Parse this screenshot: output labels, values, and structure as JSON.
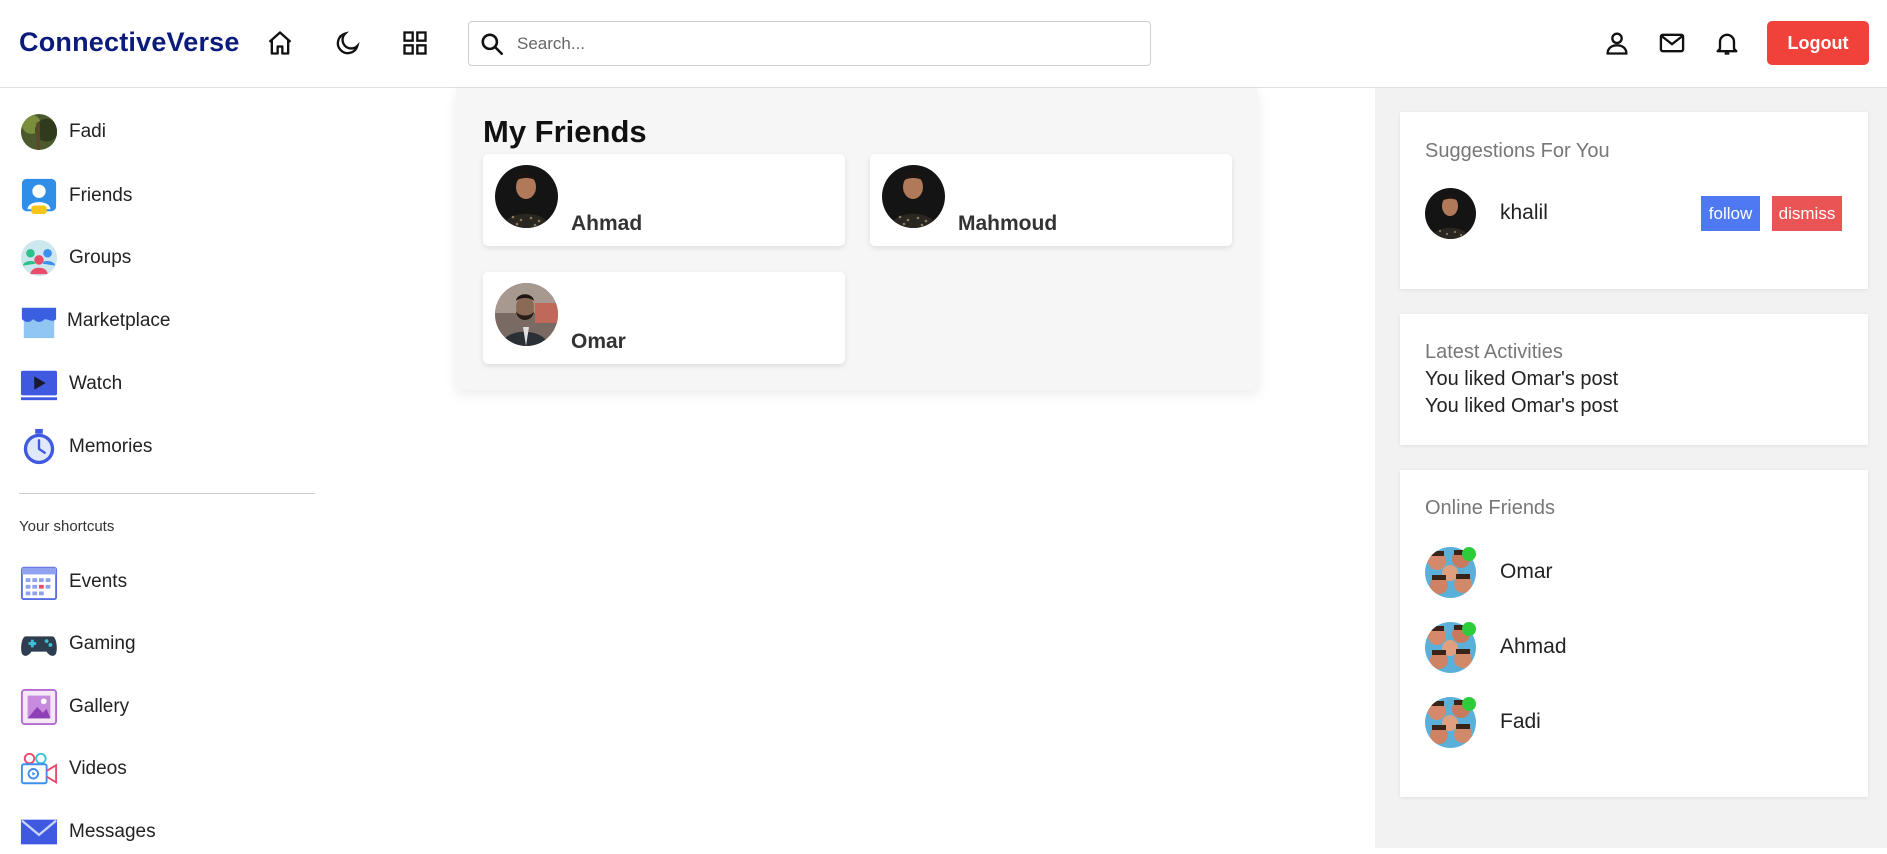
{
  "app": {
    "logo": "ConnectiveVerse"
  },
  "header": {
    "search_placeholder": "Search...",
    "logout_label": "Logout"
  },
  "sidebar": {
    "items": [
      {
        "label": "Fadi",
        "icon": "avatar-photo"
      },
      {
        "label": "Friends",
        "icon": "friends-icon"
      },
      {
        "label": "Groups",
        "icon": "groups-icon"
      },
      {
        "label": "Marketplace",
        "icon": "marketplace-icon"
      },
      {
        "label": "Watch",
        "icon": "watch-icon"
      },
      {
        "label": "Memories",
        "icon": "memories-icon"
      }
    ],
    "shortcuts_heading": "Your shortcuts",
    "shortcuts": [
      {
        "label": "Events",
        "icon": "events-icon"
      },
      {
        "label": "Gaming",
        "icon": "gaming-icon"
      },
      {
        "label": "Gallery",
        "icon": "gallery-icon"
      },
      {
        "label": "Videos",
        "icon": "videos-icon"
      },
      {
        "label": "Messages",
        "icon": "messages-icon"
      }
    ]
  },
  "main": {
    "title": "My Friends",
    "friends": [
      {
        "name": "Ahmad"
      },
      {
        "name": "Mahmoud"
      },
      {
        "name": "Omar"
      }
    ]
  },
  "rightbar": {
    "suggestions": {
      "title": "Suggestions For You",
      "name": "khalil",
      "follow_label": "follow",
      "dismiss_label": "dismiss"
    },
    "activities": {
      "title": "Latest Activities",
      "items": [
        "You liked Omar's post",
        "You liked Omar's post"
      ]
    },
    "online": {
      "title": "Online Friends",
      "friends": [
        {
          "name": "Omar"
        },
        {
          "name": "Ahmad"
        },
        {
          "name": "Fadi"
        }
      ]
    }
  },
  "colors": {
    "logo": "#0b1b7a",
    "logout": "#f0413a",
    "follow": "#4f79f2",
    "dismiss": "#ea5454",
    "online_dot": "#2ecc3a"
  }
}
